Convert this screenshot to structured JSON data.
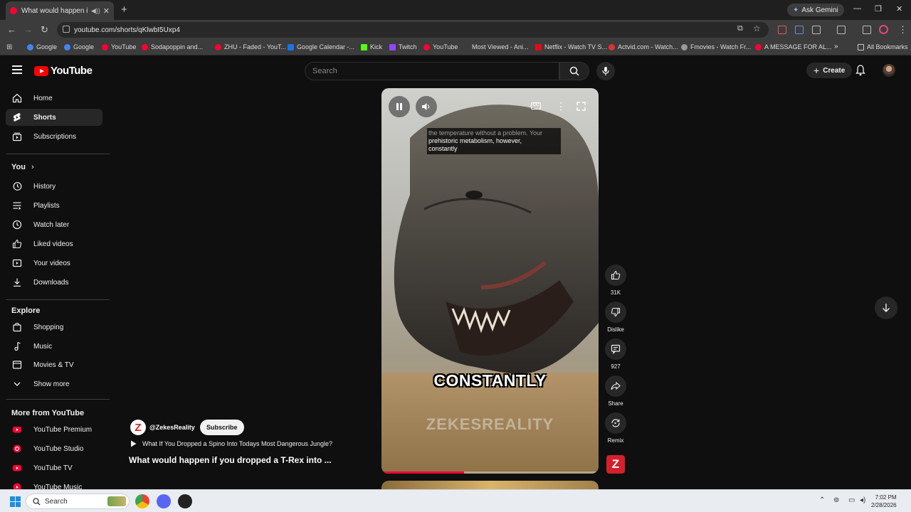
{
  "browser": {
    "tab_title": "What would happen if you",
    "address": "youtube.com/shorts/qKlwbI5Uxp4",
    "gemini_label": "Ask Gemini",
    "bookmarks": [
      "Google",
      "Google",
      "YouTube",
      "Sodapoppin and...",
      "ZHU - Faded - YouT...",
      "Google Calendar -...",
      "Kick",
      "Twitch",
      "YouTube",
      "Most Viewed - Ani...",
      "Netflix - Watch TV S...",
      "Actvid.com - Watch...",
      "Fmovies - Watch Fr...",
      "A MESSAGE FOR AL..."
    ],
    "all_bookmarks": "All Bookmarks"
  },
  "header": {
    "logo_text": "YouTube",
    "search_placeholder": "Search",
    "create_label": "Create"
  },
  "sidebar": {
    "main": [
      {
        "label": "Home",
        "icon": "home-icon"
      },
      {
        "label": "Shorts",
        "icon": "shorts-icon"
      },
      {
        "label": "Subscriptions",
        "icon": "subscriptions-icon"
      }
    ],
    "you_heading": "You",
    "you_items": [
      {
        "label": "History",
        "icon": "history-icon"
      },
      {
        "label": "Playlists",
        "icon": "playlists-icon"
      },
      {
        "label": "Watch later",
        "icon": "watch-later-icon"
      },
      {
        "label": "Liked videos",
        "icon": "liked-videos-icon"
      },
      {
        "label": "Your videos",
        "icon": "your-videos-icon"
      },
      {
        "label": "Downloads",
        "icon": "downloads-icon"
      }
    ],
    "explore_heading": "Explore",
    "explore_items": [
      {
        "label": "Shopping",
        "icon": "shopping-icon"
      },
      {
        "label": "Music",
        "icon": "music-icon"
      },
      {
        "label": "Movies & TV",
        "icon": "movies-icon"
      },
      {
        "label": "Show more",
        "icon": "chevron-down-icon"
      }
    ],
    "more_heading": "More from YouTube",
    "more_items": [
      "YouTube Premium",
      "YouTube Studio",
      "YouTube TV",
      "YouTube Music"
    ]
  },
  "video": {
    "caption_line1": "the temperature without a problem. Your",
    "caption_line2": "prehistoric metabolism, however,",
    "caption_line3": "constantly",
    "big_caption": "CONSTANTLY",
    "watermark": "ZEKESREALITY",
    "progress": 0.38
  },
  "meta": {
    "channel": "@ZekesReality",
    "subscribe": "Subscribe",
    "related": "What If You Dropped a Spino Into Todays Most Dangerous Jungle?",
    "title": "What would happen if you dropped a T-Rex into ..."
  },
  "actions": {
    "likes": "31K",
    "dislike": "Dislike",
    "comments": "927",
    "share": "Share",
    "remix": "Remix"
  },
  "taskbar": {
    "search": "Search",
    "time": "7:02 PM",
    "date": "2/28/2026"
  }
}
